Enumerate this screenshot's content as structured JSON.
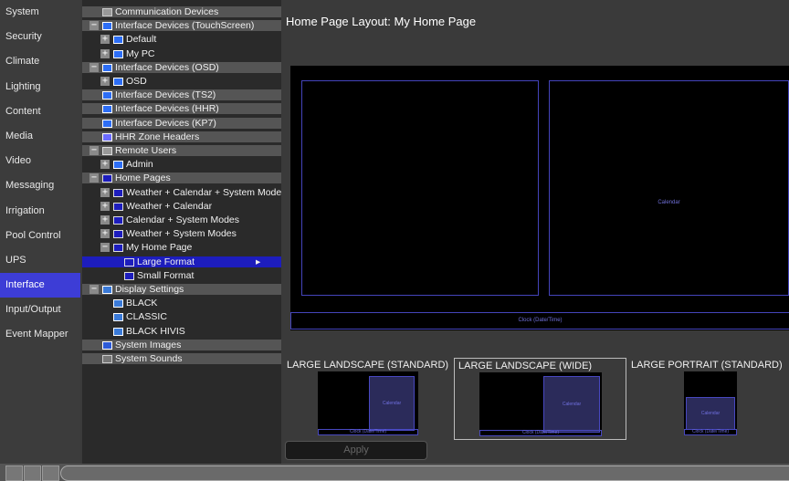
{
  "sidebar": {
    "items": [
      {
        "label": "System"
      },
      {
        "label": "Security"
      },
      {
        "label": "Climate"
      },
      {
        "label": "Lighting"
      },
      {
        "label": "Content"
      },
      {
        "label": "Media"
      },
      {
        "label": "Video"
      },
      {
        "label": "Messaging"
      },
      {
        "label": "Irrigation"
      },
      {
        "label": "Pool Control"
      },
      {
        "label": "UPS"
      },
      {
        "label": "Interface",
        "active": true
      },
      {
        "label": "Input/Output"
      },
      {
        "label": "Event Mapper"
      }
    ]
  },
  "tree": {
    "rows": [
      {
        "label": "Communication Devices",
        "depth": 0,
        "expander": "",
        "icon": "communication-icon",
        "header": true
      },
      {
        "label": "Interface Devices (TouchScreen)",
        "depth": 0,
        "expander": "−",
        "icon": "blue-device-icon",
        "header": true
      },
      {
        "label": "Default",
        "depth": 1,
        "expander": "+",
        "icon": "blue-device-icon"
      },
      {
        "label": "My PC",
        "depth": 1,
        "expander": "+",
        "icon": "blue-device-icon"
      },
      {
        "label": "Interface Devices (OSD)",
        "depth": 0,
        "expander": "−",
        "icon": "blue-device-icon",
        "header": true
      },
      {
        "label": "OSD",
        "depth": 1,
        "expander": "+",
        "icon": "blue-device-icon"
      },
      {
        "label": "Interface Devices (TS2)",
        "depth": 0,
        "expander": "",
        "icon": "blue-device-icon",
        "header": true
      },
      {
        "label": "Interface Devices (HHR)",
        "depth": 0,
        "expander": "",
        "icon": "blue-device-icon",
        "header": true
      },
      {
        "label": "Interface Devices (KP7)",
        "depth": 0,
        "expander": "",
        "icon": "blue-device-icon",
        "header": true
      },
      {
        "label": "HHR Zone Headers",
        "depth": 0,
        "expander": "",
        "icon": "zone-header-icon",
        "header": true
      },
      {
        "label": "Remote Users",
        "depth": 0,
        "expander": "−",
        "icon": "users-icon",
        "header": true
      },
      {
        "label": "Admin",
        "depth": 1,
        "expander": "+",
        "icon": "blue-device-icon"
      },
      {
        "label": "Home Pages",
        "depth": 0,
        "expander": "−",
        "icon": "page-icon",
        "header": true
      },
      {
        "label": "Weather + Calendar + System Modes",
        "depth": 1,
        "expander": "+",
        "icon": "page-icon"
      },
      {
        "label": "Weather + Calendar",
        "depth": 1,
        "expander": "+",
        "icon": "page-icon"
      },
      {
        "label": "Calendar + System Modes",
        "depth": 1,
        "expander": "+",
        "icon": "page-icon"
      },
      {
        "label": "Weather + System Modes",
        "depth": 1,
        "expander": "+",
        "icon": "page-icon"
      },
      {
        "label": "My Home Page",
        "depth": 1,
        "expander": "−",
        "icon": "page-icon"
      },
      {
        "label": "Large Format",
        "depth": 2,
        "expander": "",
        "icon": "page-icon",
        "selected": true
      },
      {
        "label": "Small Format",
        "depth": 2,
        "expander": "",
        "icon": "page-icon"
      },
      {
        "label": "Display Settings",
        "depth": 0,
        "expander": "−",
        "icon": "display-icon",
        "header": true
      },
      {
        "label": "BLACK",
        "depth": 1,
        "expander": "",
        "icon": "display-icon"
      },
      {
        "label": "CLASSIC",
        "depth": 1,
        "expander": "",
        "icon": "display-icon"
      },
      {
        "label": "BLACK HIVIS",
        "depth": 1,
        "expander": "",
        "icon": "display-icon"
      },
      {
        "label": "System Images",
        "depth": 0,
        "expander": "",
        "icon": "images-icon",
        "header": true
      },
      {
        "label": "System Sounds",
        "depth": 0,
        "expander": "",
        "icon": "sounds-icon",
        "header": true
      }
    ],
    "selected_arrow": "▸"
  },
  "preview": {
    "title": "Home Page Layout: My Home Page",
    "calendar_label": "Calendar",
    "clock_label": "Clock (Date/Time)"
  },
  "layouts": [
    {
      "name": "LARGE LANDSCAPE (STANDARD)",
      "selected": false,
      "region_label": "Calendar",
      "clock_label": "Clock (Date/Time)"
    },
    {
      "name": "LARGE LANDSCAPE (WIDE)",
      "selected": true,
      "region_label": "Calendar",
      "clock_label": "Clock (Date/Time)"
    },
    {
      "name": "LARGE PORTRAIT (STANDARD)",
      "selected": false,
      "region_label": "Calendar",
      "clock_label": "Clock (Date/Time)"
    }
  ],
  "apply_label": "Apply",
  "colors": {
    "accent": "#3d3dd6",
    "selection": "#1d1dbd",
    "region_border": "#4444bb"
  }
}
